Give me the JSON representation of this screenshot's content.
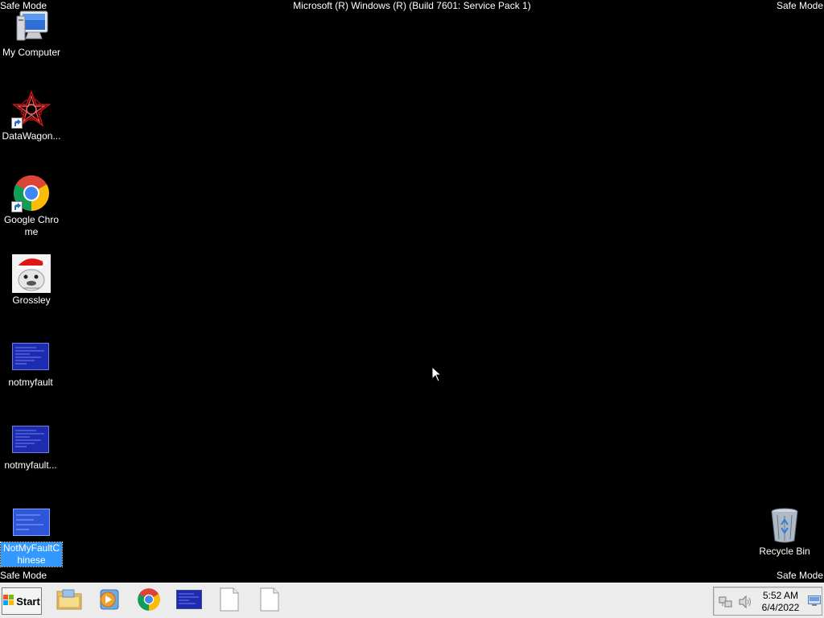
{
  "overlay": {
    "safe_mode": "Safe Mode",
    "build": "Microsoft (R) Windows (R) (Build 7601: Service Pack 1)"
  },
  "desktop_icons": [
    {
      "name": "my-computer",
      "label": "My Computer",
      "icon": "computer-icon",
      "shortcut": false,
      "selected": false
    },
    {
      "name": "datawagon",
      "label": "DataWagon...",
      "icon": "datawagon-icon",
      "shortcut": true,
      "selected": false
    },
    {
      "name": "google-chrome",
      "label": "Google Chrome",
      "icon": "chrome-icon",
      "shortcut": true,
      "selected": false
    },
    {
      "name": "grossley",
      "label": "Grossley",
      "icon": "grossley-image-icon",
      "shortcut": false,
      "selected": false
    },
    {
      "name": "notmyfault",
      "label": "notmyfault",
      "icon": "bsod-thumbnail-icon",
      "shortcut": false,
      "selected": false
    },
    {
      "name": "notmyfault-2",
      "label": "notmyfault...",
      "icon": "bsod-thumbnail-icon",
      "shortcut": false,
      "selected": false
    },
    {
      "name": "notmyfault-chinese",
      "label": "NotMyFaultChinese",
      "icon": "bsod-thumbnail-icon",
      "shortcut": false,
      "selected": true
    },
    {
      "name": "recycle-bin",
      "label": "Recycle Bin",
      "icon": "recycle-bin-icon",
      "shortcut": false,
      "selected": false
    }
  ],
  "taskbar": {
    "start_label": "Start",
    "pinned": [
      {
        "name": "explorer",
        "icon": "folder-icon"
      },
      {
        "name": "media-player",
        "icon": "media-player-icon"
      },
      {
        "name": "chrome",
        "icon": "chrome-icon"
      },
      {
        "name": "notmyfault-window",
        "icon": "bsod-thumbnail-icon"
      },
      {
        "name": "blank-doc-1",
        "icon": "document-icon"
      },
      {
        "name": "blank-doc-2",
        "icon": "document-icon"
      }
    ],
    "tray": {
      "time": "5:52 AM",
      "date": "6/4/2022",
      "icons": [
        "network-icon",
        "volume-icon",
        "show-desktop-icon"
      ]
    }
  },
  "colors": {
    "desktop_bg": "#000000",
    "selection": "#3399ff",
    "taskbar_bg": "#ececec",
    "bsod_blue": "#1c2bb0"
  }
}
